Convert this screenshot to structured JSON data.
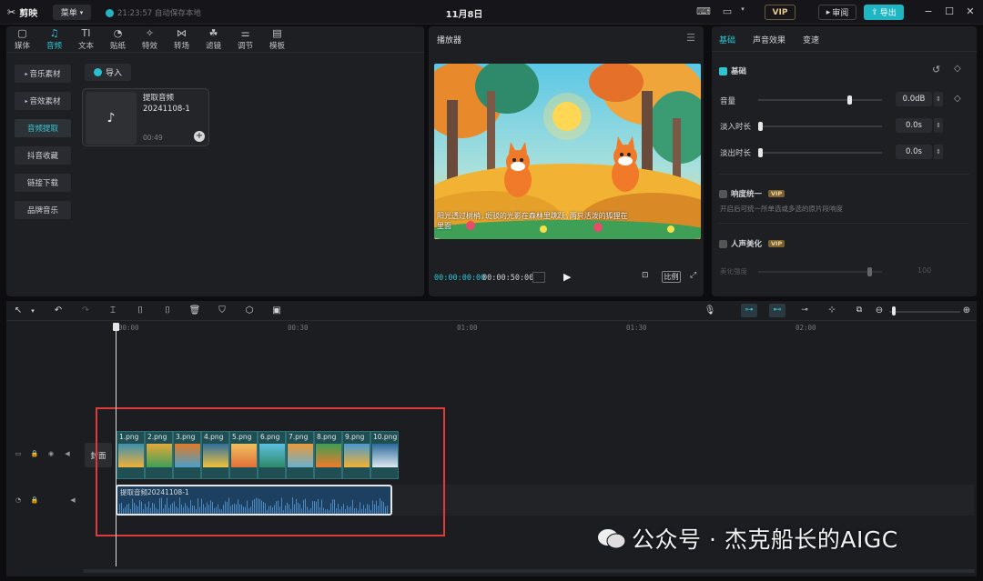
{
  "titlebar": {
    "logo": "剪映",
    "menu": "菜单",
    "autosave": "21:23:57 自动保存本地",
    "title": "11月8日",
    "vip": "VIP",
    "review": "审阅",
    "export": "导出"
  },
  "media_tabs": [
    {
      "label": "媒体",
      "icon": "▢"
    },
    {
      "label": "音频",
      "icon": "♫"
    },
    {
      "label": "文本",
      "icon": "TI"
    },
    {
      "label": "贴纸",
      "icon": "◔"
    },
    {
      "label": "特效",
      "icon": "✧"
    },
    {
      "label": "转场",
      "icon": "⋈"
    },
    {
      "label": "滤镜",
      "icon": "☘"
    },
    {
      "label": "调节",
      "icon": "⚌"
    },
    {
      "label": "模板",
      "icon": "▤"
    }
  ],
  "audio_side": [
    "音乐素材",
    "音效素材",
    "音频提取",
    "抖音收藏",
    "链接下载",
    "品牌音乐"
  ],
  "import_label": "导入",
  "audio_card": {
    "name": "提取音频20241108-1",
    "duration": "00:49"
  },
  "player": {
    "title": "播放器",
    "subtitle": "阳光透过树梢,斑驳的光影在森林里跳跃,两只活泼的狐狸在",
    "subtitle2": "里面",
    "current": "00:00:00:00",
    "total": "00:00:50:00",
    "ratio": "比例"
  },
  "props": {
    "tabs": [
      "基础",
      "声音效果",
      "变速"
    ],
    "section_basic": "基础",
    "volume_label": "音量",
    "volume_value": "0.0dB",
    "volume_level": 0.73,
    "fadein_label": "淡入时长",
    "fadein_value": "0.0s",
    "fadeout_label": "淡出时长",
    "fadeout_value": "0.0s",
    "loudness_label": "响度统一",
    "loudness_desc": "开启后可统一所单选或多选的原片段响度",
    "voice_label": "人声美化",
    "voice_sub": "美化强度",
    "voice_value": "100",
    "vip_tag": "VIP"
  },
  "timeline": {
    "ticks": [
      "00:00",
      "00:30",
      "01:00",
      "01:30",
      "02:00"
    ],
    "cover": "封面",
    "clips": [
      "1.png",
      "2.png",
      "3.png",
      "4.png",
      "5.png",
      "6.png",
      "7.png",
      "8.png",
      "9.png",
      "10.png"
    ],
    "audio_clip": "提取音频20241108-1"
  },
  "watermark": "公众号 · 杰克船长的AIGC",
  "colors": {
    "accent": "#2fc4d2",
    "highlight_box": "#e03a3a",
    "audio_clip": "#1d4060",
    "image_clip": "#1f4e53"
  }
}
